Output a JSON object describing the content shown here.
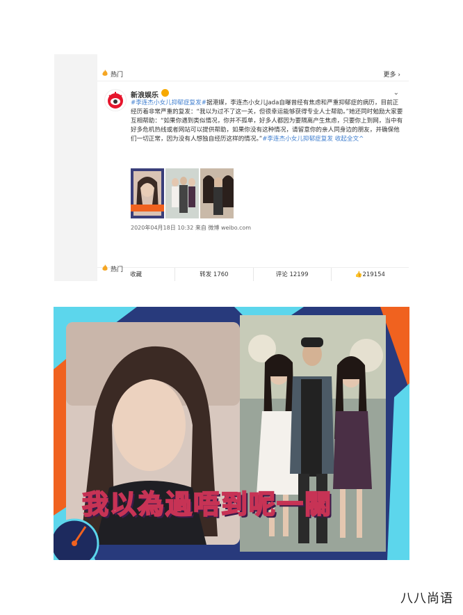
{
  "weibo_card": {
    "hot_label_top": "热门",
    "more_label": "更多",
    "account_name": "新浪娱乐",
    "post_text": {
      "tag": "#李连杰小女儿抑郁症复发#",
      "body": "据港媒，李连杰小女儿Jada自曝曾经有焦虑和严重抑郁症的病历，目前正经历着非常严重的复发：“我以为过不了这一关，但很幸运能够获得专业人士帮助。”她还同时勉励大家要互相帮助：“如果你遇到类似情况，你并不孤单，好多人都因为要隔离产生焦虑，只要你上到网，当中有好多危机热线或者网站可以提供帮助，如果你没有这种情况，请留意你的亲人同身边的朋友，并确保他们一切正常，因为没有人想独自经历这样的情况。”",
      "trailing_tag": "#李连杰小女儿抑郁症复发",
      "collapse_label": "收起全文"
    },
    "timestamp": "2020年04月18日 10:32 来自 微博 weibo.com",
    "actions": {
      "collect": "收藏",
      "repost": "转发 1760",
      "comment": "评论 12199",
      "like": "219154"
    },
    "hot_label_bottom": "热门"
  },
  "banner": {
    "caption": "我以為過唔到呢一關"
  },
  "watermark": "八八尚语",
  "colors": {
    "link": "#3f7ecf",
    "banner_navy": "#283a7c",
    "banner_orange": "#f0621f",
    "banner_cyan": "#5cd6ec",
    "caption_stroke": "#c73355"
  }
}
